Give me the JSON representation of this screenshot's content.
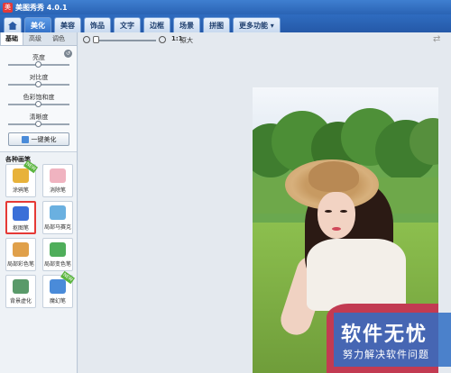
{
  "window": {
    "title": "美图秀秀 4.0.1",
    "logo": "美"
  },
  "tabs": [
    {
      "label": ""
    },
    {
      "label": "美化"
    },
    {
      "label": "美容"
    },
    {
      "label": "饰品"
    },
    {
      "label": "文字"
    },
    {
      "label": "边框"
    },
    {
      "label": "场景"
    },
    {
      "label": "拼图"
    },
    {
      "label": "更多功能 ▾"
    }
  ],
  "subtabs": [
    "基础",
    "高级",
    "调色"
  ],
  "adjust": {
    "sliders": [
      {
        "label": "亮度"
      },
      {
        "label": "对比度"
      },
      {
        "label": "色彩饱和度"
      },
      {
        "label": "清晰度"
      }
    ],
    "onekey_label": "一键美化"
  },
  "brushes": {
    "title": "各种画笔",
    "items": [
      {
        "label": "涂鸦笔",
        "badge": "NEW",
        "color": "#e8b23a"
      },
      {
        "label": "消除笔",
        "badge": "",
        "color": "#f0b3c0"
      },
      {
        "label": "抠图笔",
        "badge": "",
        "color": "#3a6fd8"
      },
      {
        "label": "局部马赛克",
        "badge": "",
        "color": "#6ab0e0"
      },
      {
        "label": "局部彩色笔",
        "badge": "",
        "color": "#e0a04a"
      },
      {
        "label": "局部变色笔",
        "badge": "",
        "color": "#4fae5a"
      },
      {
        "label": "背景虚化",
        "badge": "",
        "color": "#5a9a6a"
      },
      {
        "label": "魔幻笔",
        "badge": "NEW",
        "color": "#4a8bd9"
      }
    ]
  },
  "toolbar": {
    "original_icon": "1:1",
    "original_label": "原大"
  },
  "watermark": {
    "big": "软件无忧",
    "small": "努力解决软件问题"
  }
}
